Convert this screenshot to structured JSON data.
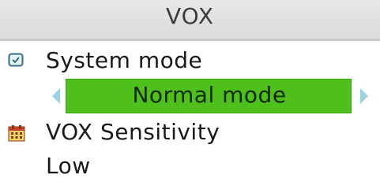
{
  "header": {
    "title": "VOX"
  },
  "system_mode": {
    "label": "System mode",
    "icon": "mode-icon",
    "value": "Normal mode"
  },
  "vox_sensitivity": {
    "label": "VOX Sensitivity",
    "icon": "calendar-icon",
    "value": "Low"
  },
  "colors": {
    "selection_green": "#4fbf1c",
    "arrow_blue": "#9ed2e3",
    "header_gray": "#dadada"
  }
}
